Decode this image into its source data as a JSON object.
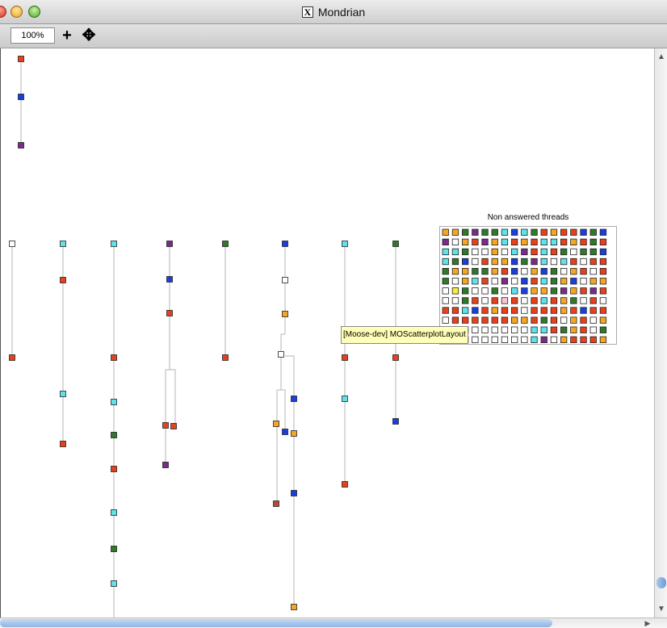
{
  "window": {
    "title": "Mondrian"
  },
  "toolbar": {
    "zoom": "100%",
    "zoom_in_label": "+",
    "move_label": "✥"
  },
  "tooltip": {
    "text": "[Moose-dev] MOScatterplotLayout"
  },
  "matrix": {
    "label": "Non answered threads",
    "rows": [
      [
        "orange",
        "orange",
        "green",
        "purple",
        "green",
        "green",
        "cyan",
        "blue",
        "cyan",
        "green",
        "red",
        "orange",
        "red",
        "red",
        "blue",
        "green",
        "blue"
      ],
      [
        "purple",
        "white",
        "orange",
        "red",
        "purple",
        "orange",
        "cyan",
        "red",
        "orange",
        "red",
        "cyan",
        "cyan",
        "red",
        "orange",
        "red",
        "green",
        "red"
      ],
      [
        "cyan",
        "cyan",
        "green",
        "white",
        "white",
        "orange",
        "white",
        "cyan",
        "purple",
        "red",
        "cyan",
        "red",
        "green",
        "white",
        "green",
        "green",
        "blue"
      ],
      [
        "cyan",
        "green",
        "blue",
        "white",
        "red",
        "orange",
        "orange",
        "blue",
        "green",
        "purple",
        "cyan",
        "white",
        "cyan",
        "red",
        "white",
        "red",
        "red"
      ],
      [
        "green",
        "orange",
        "orange",
        "green",
        "green",
        "orange",
        "red",
        "blue",
        "white",
        "orange",
        "blue",
        "green",
        "white",
        "orange",
        "red",
        "white",
        "red"
      ],
      [
        "green",
        "white",
        "orange",
        "cyan",
        "red",
        "white",
        "purple",
        "white",
        "blue",
        "red",
        "cyan",
        "green",
        "orange",
        "blue",
        "white",
        "orange",
        "orange"
      ],
      [
        "white",
        "yellow",
        "green",
        "white",
        "white",
        "green",
        "white",
        "cyan",
        "blue",
        "orange",
        "orange",
        "green",
        "purple",
        "orange",
        "red",
        "purple",
        "red"
      ],
      [
        "white",
        "white",
        "green",
        "red",
        "white",
        "red",
        "pink",
        "red",
        "white",
        "red",
        "cyan",
        "red",
        "orange",
        "green",
        "white",
        "red",
        "white"
      ],
      [
        "red",
        "red",
        "cyan",
        "blue",
        "red",
        "orange",
        "red",
        "red",
        "white",
        "red",
        "red",
        "red",
        "orange",
        "red",
        "blue",
        "red",
        "red"
      ],
      [
        "white",
        "red",
        "red",
        "red",
        "red",
        "red",
        "red",
        "orange",
        "orange",
        "red",
        "green",
        "red",
        "white",
        "orange",
        "red",
        "white",
        "orange"
      ],
      [
        "white",
        "white",
        "white",
        "white",
        "white",
        "white",
        "white",
        "white",
        "white",
        "cyan",
        "cyan",
        "red",
        "green",
        "orange",
        "red",
        "white",
        "green"
      ],
      [
        "white",
        "white",
        "white",
        "white",
        "white",
        "white",
        "white",
        "white",
        "white",
        "cyan",
        "purple",
        "white",
        "orange",
        "red",
        "red",
        "red",
        "orange"
      ]
    ]
  },
  "colors": {
    "red": "#e8401c",
    "blue": "#1a3fe0",
    "purple": "#7a2a8a",
    "white": "#ffffff",
    "cyan": "#5fe2ea",
    "green": "#2f7a2a",
    "orange": "#f6a623",
    "yellow": "#f7f03a",
    "pink": "#f7c6d2",
    "brown": "#b54a3a"
  },
  "graph": {
    "nodes": [
      {
        "id": "n1",
        "color": "red"
      },
      {
        "id": "n2",
        "color": "blue"
      },
      {
        "id": "n3",
        "color": "purple"
      },
      {
        "id": "a1",
        "color": "white"
      },
      {
        "id": "a2",
        "color": "red"
      },
      {
        "id": "b1",
        "color": "cyan"
      },
      {
        "id": "b2",
        "color": "red"
      },
      {
        "id": "b3",
        "color": "cyan"
      },
      {
        "id": "b4",
        "color": "red"
      },
      {
        "id": "c1",
        "color": "cyan"
      },
      {
        "id": "c2",
        "color": "red"
      },
      {
        "id": "c3",
        "color": "cyan"
      },
      {
        "id": "c4",
        "color": "green"
      },
      {
        "id": "c5",
        "color": "red"
      },
      {
        "id": "c6",
        "color": "cyan"
      },
      {
        "id": "c7",
        "color": "green"
      },
      {
        "id": "c8",
        "color": "cyan"
      },
      {
        "id": "d1",
        "color": "purple"
      },
      {
        "id": "d2",
        "color": "blue"
      },
      {
        "id": "d3",
        "color": "red"
      },
      {
        "id": "d4",
        "color": "red"
      },
      {
        "id": "d5",
        "color": "red"
      },
      {
        "id": "d6",
        "color": "purple"
      },
      {
        "id": "e1",
        "color": "green"
      },
      {
        "id": "e2",
        "color": "red"
      },
      {
        "id": "f1",
        "color": "blue"
      },
      {
        "id": "f2",
        "color": "white"
      },
      {
        "id": "f3",
        "color": "orange"
      },
      {
        "id": "f4",
        "color": "white"
      },
      {
        "id": "f5",
        "color": "blue"
      },
      {
        "id": "f6",
        "color": "orange"
      },
      {
        "id": "f7",
        "color": "blue"
      },
      {
        "id": "f8",
        "color": "orange"
      },
      {
        "id": "f9",
        "color": "brown"
      },
      {
        "id": "f10",
        "color": "blue"
      },
      {
        "id": "f11",
        "color": "orange"
      },
      {
        "id": "g1",
        "color": "cyan"
      },
      {
        "id": "g2",
        "color": "red"
      },
      {
        "id": "g3",
        "color": "cyan"
      },
      {
        "id": "g4",
        "color": "red"
      },
      {
        "id": "h1",
        "color": "green"
      },
      {
        "id": "h2",
        "color": "red"
      },
      {
        "id": "h3",
        "color": "blue"
      }
    ]
  }
}
